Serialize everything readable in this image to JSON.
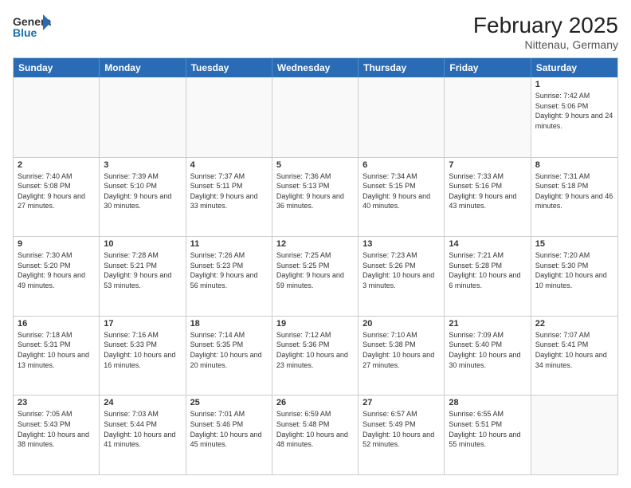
{
  "header": {
    "logo_general": "General",
    "logo_blue": "Blue",
    "month_title": "February 2025",
    "location": "Nittenau, Germany"
  },
  "weekdays": [
    "Sunday",
    "Monday",
    "Tuesday",
    "Wednesday",
    "Thursday",
    "Friday",
    "Saturday"
  ],
  "weeks": [
    [
      {
        "day": "",
        "info": ""
      },
      {
        "day": "",
        "info": ""
      },
      {
        "day": "",
        "info": ""
      },
      {
        "day": "",
        "info": ""
      },
      {
        "day": "",
        "info": ""
      },
      {
        "day": "",
        "info": ""
      },
      {
        "day": "1",
        "info": "Sunrise: 7:42 AM\nSunset: 5:06 PM\nDaylight: 9 hours and 24 minutes."
      }
    ],
    [
      {
        "day": "2",
        "info": "Sunrise: 7:40 AM\nSunset: 5:08 PM\nDaylight: 9 hours and 27 minutes."
      },
      {
        "day": "3",
        "info": "Sunrise: 7:39 AM\nSunset: 5:10 PM\nDaylight: 9 hours and 30 minutes."
      },
      {
        "day": "4",
        "info": "Sunrise: 7:37 AM\nSunset: 5:11 PM\nDaylight: 9 hours and 33 minutes."
      },
      {
        "day": "5",
        "info": "Sunrise: 7:36 AM\nSunset: 5:13 PM\nDaylight: 9 hours and 36 minutes."
      },
      {
        "day": "6",
        "info": "Sunrise: 7:34 AM\nSunset: 5:15 PM\nDaylight: 9 hours and 40 minutes."
      },
      {
        "day": "7",
        "info": "Sunrise: 7:33 AM\nSunset: 5:16 PM\nDaylight: 9 hours and 43 minutes."
      },
      {
        "day": "8",
        "info": "Sunrise: 7:31 AM\nSunset: 5:18 PM\nDaylight: 9 hours and 46 minutes."
      }
    ],
    [
      {
        "day": "9",
        "info": "Sunrise: 7:30 AM\nSunset: 5:20 PM\nDaylight: 9 hours and 49 minutes."
      },
      {
        "day": "10",
        "info": "Sunrise: 7:28 AM\nSunset: 5:21 PM\nDaylight: 9 hours and 53 minutes."
      },
      {
        "day": "11",
        "info": "Sunrise: 7:26 AM\nSunset: 5:23 PM\nDaylight: 9 hours and 56 minutes."
      },
      {
        "day": "12",
        "info": "Sunrise: 7:25 AM\nSunset: 5:25 PM\nDaylight: 9 hours and 59 minutes."
      },
      {
        "day": "13",
        "info": "Sunrise: 7:23 AM\nSunset: 5:26 PM\nDaylight: 10 hours and 3 minutes."
      },
      {
        "day": "14",
        "info": "Sunrise: 7:21 AM\nSunset: 5:28 PM\nDaylight: 10 hours and 6 minutes."
      },
      {
        "day": "15",
        "info": "Sunrise: 7:20 AM\nSunset: 5:30 PM\nDaylight: 10 hours and 10 minutes."
      }
    ],
    [
      {
        "day": "16",
        "info": "Sunrise: 7:18 AM\nSunset: 5:31 PM\nDaylight: 10 hours and 13 minutes."
      },
      {
        "day": "17",
        "info": "Sunrise: 7:16 AM\nSunset: 5:33 PM\nDaylight: 10 hours and 16 minutes."
      },
      {
        "day": "18",
        "info": "Sunrise: 7:14 AM\nSunset: 5:35 PM\nDaylight: 10 hours and 20 minutes."
      },
      {
        "day": "19",
        "info": "Sunrise: 7:12 AM\nSunset: 5:36 PM\nDaylight: 10 hours and 23 minutes."
      },
      {
        "day": "20",
        "info": "Sunrise: 7:10 AM\nSunset: 5:38 PM\nDaylight: 10 hours and 27 minutes."
      },
      {
        "day": "21",
        "info": "Sunrise: 7:09 AM\nSunset: 5:40 PM\nDaylight: 10 hours and 30 minutes."
      },
      {
        "day": "22",
        "info": "Sunrise: 7:07 AM\nSunset: 5:41 PM\nDaylight: 10 hours and 34 minutes."
      }
    ],
    [
      {
        "day": "23",
        "info": "Sunrise: 7:05 AM\nSunset: 5:43 PM\nDaylight: 10 hours and 38 minutes."
      },
      {
        "day": "24",
        "info": "Sunrise: 7:03 AM\nSunset: 5:44 PM\nDaylight: 10 hours and 41 minutes."
      },
      {
        "day": "25",
        "info": "Sunrise: 7:01 AM\nSunset: 5:46 PM\nDaylight: 10 hours and 45 minutes."
      },
      {
        "day": "26",
        "info": "Sunrise: 6:59 AM\nSunset: 5:48 PM\nDaylight: 10 hours and 48 minutes."
      },
      {
        "day": "27",
        "info": "Sunrise: 6:57 AM\nSunset: 5:49 PM\nDaylight: 10 hours and 52 minutes."
      },
      {
        "day": "28",
        "info": "Sunrise: 6:55 AM\nSunset: 5:51 PM\nDaylight: 10 hours and 55 minutes."
      },
      {
        "day": "",
        "info": ""
      }
    ]
  ]
}
